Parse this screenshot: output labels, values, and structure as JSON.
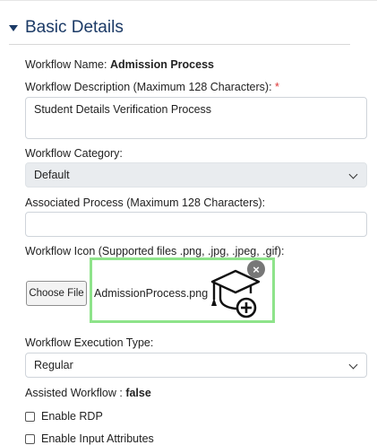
{
  "section": {
    "title": "Basic Details"
  },
  "workflow_name": {
    "label": "Workflow Name:",
    "value": "Admission Process"
  },
  "workflow_description": {
    "label": "Workflow Description (Maximum 128 Characters):",
    "required_mark": "*",
    "value": "Student Details Verification Process"
  },
  "workflow_category": {
    "label": "Workflow Category:",
    "selected": "Default"
  },
  "associated_process": {
    "label": "Associated Process (Maximum 128 Characters):",
    "value": ""
  },
  "workflow_icon": {
    "label": "Workflow Icon (Supported files .png, .jpg, .jpeg, .gif):",
    "choose_label": "Choose File",
    "file_name": "AdmissionProcess.png",
    "remove_label": "×",
    "highlight_color": "#8ee38a"
  },
  "execution_type": {
    "label": "Workflow Execution Type:",
    "selected": "Regular"
  },
  "assisted_workflow": {
    "label": "Assisted Workflow :",
    "value": "false"
  },
  "checkboxes": [
    {
      "label": "Enable RDP",
      "checked": false
    },
    {
      "label": "Enable Input Attributes",
      "checked": false
    }
  ],
  "colors": {
    "header": "#1b3a66",
    "required": "#d33333",
    "select_gray": "#e9ecef"
  }
}
